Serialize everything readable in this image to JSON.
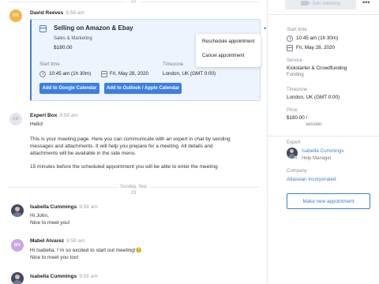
{
  "chat": {
    "top_date": "22",
    "messages": [
      {
        "id": "dk",
        "initials": "DK",
        "sender": "David Reeves",
        "time": "9:58 am"
      },
      {
        "id": "eb",
        "initials": "EB",
        "sender": "Expert Box",
        "time": "9:58 am",
        "lines": [
          "Hello!",
          "",
          "This is your meeting page. Here you can communicate with an expert in chat by sending",
          "messages and attachments. It will help you prepare for a meeting. All details and",
          "attachments will be available in the side menu.",
          "",
          "15 minutes before the scheduled appointment you will be able to enter the meeting"
        ]
      },
      {
        "id": "ic1",
        "sender": "Isabella Cummings",
        "time": "9:58 am",
        "lines": [
          "Hi John,",
          "Nice to meet you!"
        ]
      },
      {
        "id": "mv",
        "initials": "MV",
        "sender": "Mabel Alvarez",
        "time": "9:58 am",
        "lines": [
          "Hi Isabella, I`m so excited to start out meeting!😊",
          "Nice to meet you too!"
        ]
      },
      {
        "id": "ic2",
        "sender": "Isabella Cummings",
        "time": "9:58 am"
      }
    ],
    "separator": {
      "line1": "Sunday, Sep",
      "line2": "23"
    }
  },
  "appointment": {
    "title": "Selling on Amazon & Ebay",
    "category": "Sales & Marketing",
    "price": "$180.00",
    "start_time_label": "Start time",
    "start_time": "10:45 am (1h 30m)",
    "date": "Fri, May 28, 2020",
    "timezone_label": "Timezone",
    "timezone": "London, UK (GMT 0:00)",
    "google_button": "Add to Google Calendar",
    "outlook_button": "Add to Outlook / Apple Calendar",
    "menu": {
      "reschedule": "Reschedule appointment",
      "cancel": "Cancel appointment"
    }
  },
  "side": {
    "join_button": "Join meeting",
    "start_time_label": "Start time",
    "start_time": "10:45 am (1h 30m)",
    "date": "Fri, May 28, 2020",
    "service_label": "Service",
    "service": "Kickstarter & Crowdfunding",
    "service_sub": "Funding",
    "timezone_label": "Timezone",
    "timezone": "London, UK (GMT 0:00)",
    "price_label": "Price",
    "price": "$180.00 /",
    "price_unit": "session",
    "expert_label": "Expert",
    "expert_name": "Isabella Cummings",
    "expert_role": "Help Manager",
    "company_label": "Company",
    "company": "Atlassian Incorporated",
    "new_appointment_button": "Make new appointment"
  },
  "colors": {
    "accent": "#3d7fe0",
    "card_bg": "#eef4fd",
    "online": "#33c36a"
  }
}
